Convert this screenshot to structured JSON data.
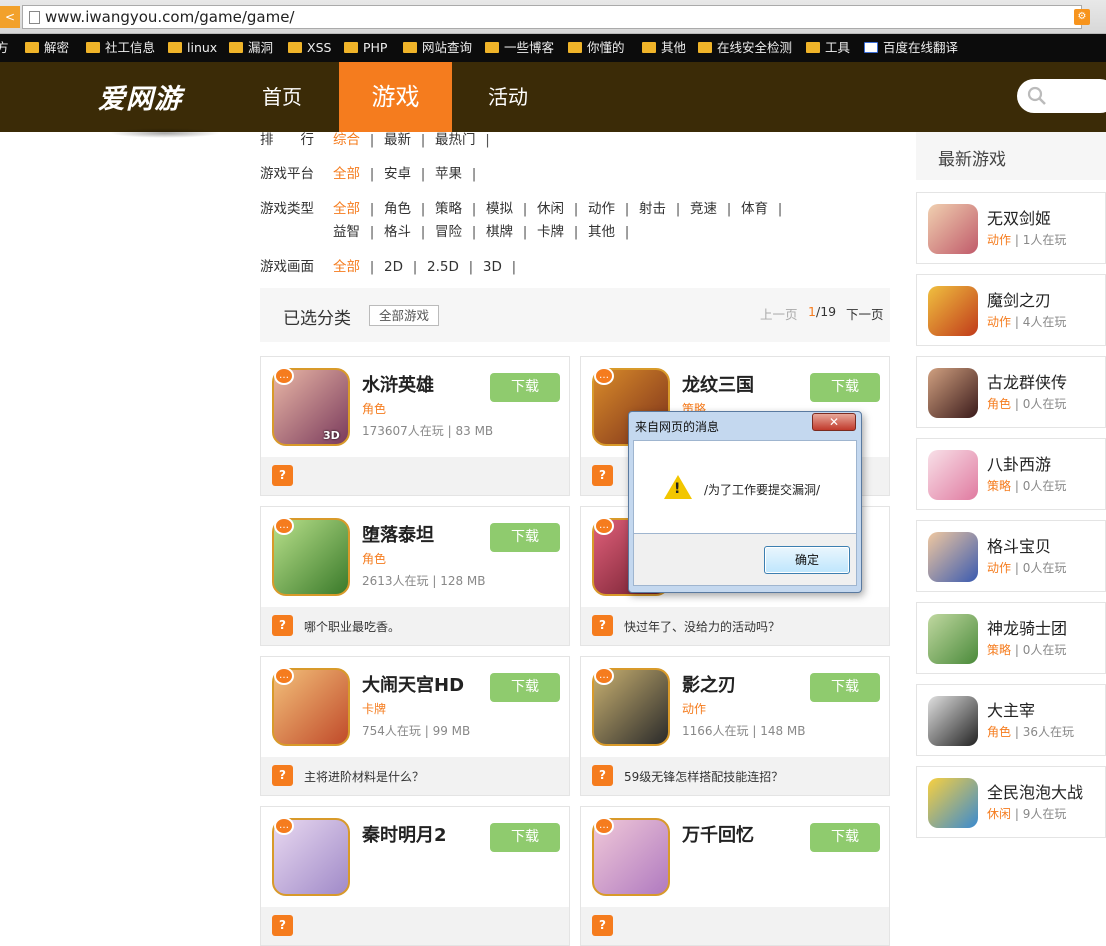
{
  "browser": {
    "url": "www.iwangyou.com/game/game/",
    "bookmarks": [
      {
        "label": "方",
        "folder": false
      },
      {
        "label": "解密",
        "folder": true
      },
      {
        "label": "社工信息",
        "folder": true
      },
      {
        "label": "linux",
        "folder": true
      },
      {
        "label": "漏洞",
        "folder": true
      },
      {
        "label": "XSS",
        "folder": true
      },
      {
        "label": "PHP",
        "folder": true
      },
      {
        "label": "网站查询",
        "folder": true
      },
      {
        "label": "一些博客",
        "folder": true
      },
      {
        "label": "你懂的",
        "folder": true
      },
      {
        "label": "其他",
        "folder": true
      },
      {
        "label": "在线安全检测",
        "folder": true
      },
      {
        "label": "工具",
        "folder": true
      },
      {
        "label": "百度在线翻译",
        "folder": false
      }
    ]
  },
  "site": {
    "logo": "爱网游",
    "nav": [
      {
        "label": "首页",
        "active": false
      },
      {
        "label": "游戏",
        "active": true
      },
      {
        "label": "活动",
        "active": false
      }
    ]
  },
  "filters": {
    "sort": {
      "label": "排　　行",
      "options": [
        "综合",
        "最新",
        "最热门"
      ],
      "selected": 0
    },
    "platform": {
      "label": "游戏平台",
      "options": [
        "全部",
        "安卓",
        "苹果"
      ],
      "selected": 0
    },
    "type_row1": {
      "label": "游戏类型",
      "options": [
        "全部",
        "角色",
        "策略",
        "模拟",
        "休闲",
        "动作",
        "射击",
        "竞速",
        "体育"
      ],
      "selected": 0
    },
    "type_row2": {
      "options": [
        "益智",
        "格斗",
        "冒险",
        "棋牌",
        "卡牌",
        "其他"
      ]
    },
    "graphics": {
      "label": "游戏画面",
      "options": [
        "全部",
        "2D",
        "2.5D",
        "3D"
      ],
      "selected": 0
    }
  },
  "selected_bar": {
    "title": "已选分类",
    "chip": "全部游戏",
    "prev": "上一页",
    "page_current": "1",
    "page_total": "/19",
    "next": "下一页"
  },
  "games": [
    {
      "title": "水浒英雄",
      "tag": "角色",
      "meta": "173607人在玩 | 83 MB",
      "download": "下载",
      "question": "",
      "colors": [
        "#7a3a5c",
        "#e9b7a6"
      ]
    },
    {
      "title": "龙纹三国",
      "tag": "策略",
      "meta": "",
      "download": "下载",
      "question": "",
      "colors": [
        "#7a2f1a",
        "#d98b2a"
      ]
    },
    {
      "title": "堕落泰坦",
      "tag": "角色",
      "meta": "2613人在玩 | 128 MB",
      "download": "下载",
      "question": "哪个职业最吃香。",
      "colors": [
        "#3a7a2a",
        "#b8e08a"
      ]
    },
    {
      "title": "",
      "tag": "",
      "meta": "",
      "download": "",
      "question": "快过年了、没给力的活动吗？",
      "colors": [
        "#6a1a2a",
        "#e0607a"
      ]
    },
    {
      "title": "大闹天宫HD",
      "tag": "卡牌",
      "meta": "754人在玩 | 99 MB",
      "download": "下载",
      "question": "主将进阶材料是什么？",
      "colors": [
        "#c04a2a",
        "#f3c07a"
      ]
    },
    {
      "title": "影之刃",
      "tag": "动作",
      "meta": "1166人在玩 | 148 MB",
      "download": "下载",
      "question": "59级无锋怎样搭配技能连招？",
      "colors": [
        "#2a2a2a",
        "#c8b070"
      ]
    },
    {
      "title": "秦时明月2",
      "tag": "",
      "meta": "",
      "download": "下载",
      "question": "",
      "colors": [
        "#a08ac8",
        "#e8d8f0"
      ]
    },
    {
      "title": "万千回忆",
      "tag": "",
      "meta": "",
      "download": "下载",
      "question": "",
      "colors": [
        "#b07ac0",
        "#f0c8d8"
      ]
    }
  ],
  "card_badge_3d": "3D",
  "sidebar": {
    "title": "最新游戏",
    "items": [
      {
        "name": "无双剑姬",
        "tag": "动作",
        "count": " | 1人在玩",
        "colors": [
          "#c05a6a",
          "#f0d0b0"
        ]
      },
      {
        "name": "魔剑之刃",
        "tag": "动作",
        "count": " | 4人在玩",
        "colors": [
          "#c03a1a",
          "#f0c040"
        ]
      },
      {
        "name": "古龙群侠传",
        "tag": "角色",
        "count": " | 0人在玩",
        "colors": [
          "#3a1a1a",
          "#d0a080"
        ]
      },
      {
        "name": "八卦西游",
        "tag": "策略",
        "count": " | 0人在玩",
        "colors": [
          "#e07aa0",
          "#f8e0e8"
        ]
      },
      {
        "name": "格斗宝贝",
        "tag": "动作",
        "count": " | 0人在玩",
        "colors": [
          "#3a5ab0",
          "#f0c8a0"
        ]
      },
      {
        "name": "神龙骑士团",
        "tag": "策略",
        "count": " | 0人在玩",
        "colors": [
          "#4a8a3a",
          "#c0d8a0"
        ]
      },
      {
        "name": "大主宰",
        "tag": "角色",
        "count": " | 36人在玩",
        "colors": [
          "#222222",
          "#e0e0e0"
        ]
      },
      {
        "name": "全民泡泡大战",
        "tag": "休闲",
        "count": " | 9人在玩",
        "colors": [
          "#3a8ad0",
          "#f8d040"
        ]
      }
    ]
  },
  "dialog": {
    "title": "来自网页的消息",
    "close": "✕",
    "message": "/为了工作要提交漏洞/",
    "ok": "确定"
  },
  "accent": "#f57c1e",
  "download_green": "#8fcb6e",
  "header_brown": "#3b2b07"
}
